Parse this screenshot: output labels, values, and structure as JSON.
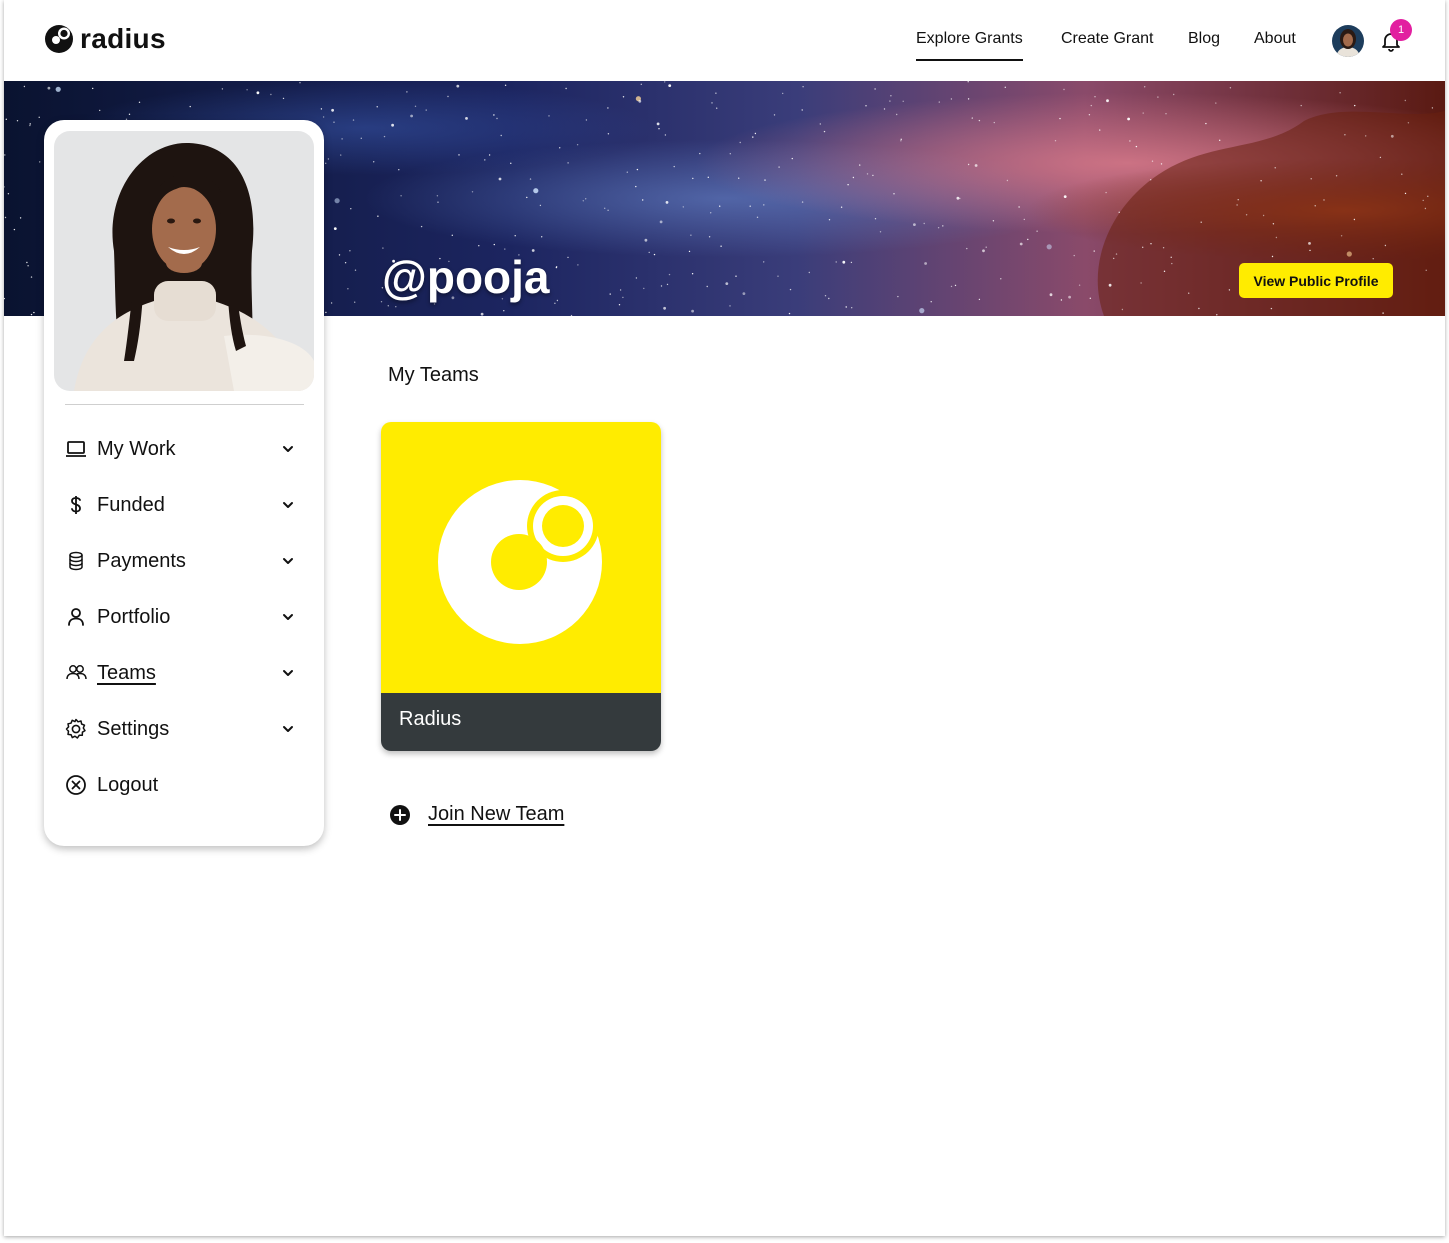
{
  "header": {
    "logo_text": "radius",
    "nav": {
      "explore": "Explore Grants",
      "create": "Create Grant",
      "blog": "Blog",
      "about": "About"
    },
    "notification_count": "1",
    "icons": [
      "logo-icon",
      "avatar",
      "bell-icon"
    ]
  },
  "banner": {
    "handle": "@pooja",
    "view_profile_label": "View Public Profile"
  },
  "sidebar": {
    "items": [
      {
        "label": "My Work",
        "icon": "laptop-icon",
        "has_chevron": true
      },
      {
        "label": "Funded",
        "icon": "dollar-icon",
        "has_chevron": true
      },
      {
        "label": "Payments",
        "icon": "database-icon",
        "has_chevron": true
      },
      {
        "label": "Portfolio",
        "icon": "user-icon",
        "has_chevron": true
      },
      {
        "label": "Teams",
        "icon": "users-icon",
        "has_chevron": true,
        "active": true
      },
      {
        "label": "Settings",
        "icon": "gear-icon",
        "has_chevron": true
      },
      {
        "label": "Logout",
        "icon": "x-circle-icon",
        "has_chevron": false
      }
    ]
  },
  "main": {
    "section_title": "My Teams",
    "teams": [
      {
        "name": "Radius"
      }
    ],
    "join_label": "Join New Team"
  },
  "colors": {
    "accent_yellow": "#ffec00",
    "badge_pink": "#e21fa0",
    "card_footer": "#343a3d"
  }
}
